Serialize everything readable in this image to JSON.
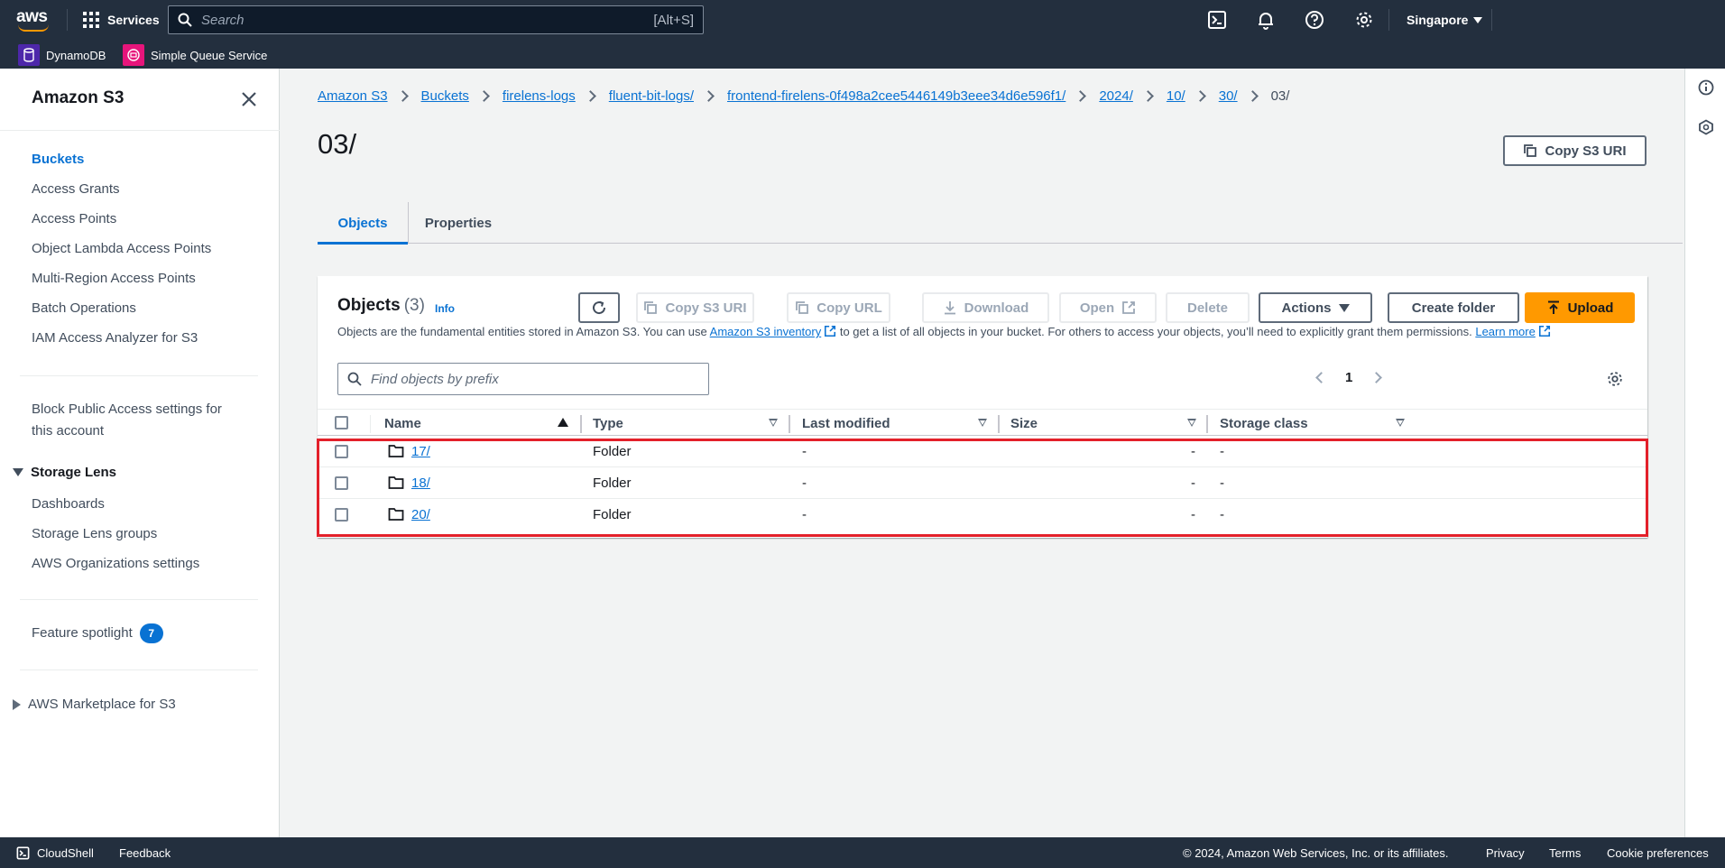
{
  "topnav": {
    "services_label": "Services",
    "search_placeholder": "Search",
    "search_shortcut": "[Alt+S]",
    "region": "Singapore"
  },
  "favorites": [
    {
      "label": "DynamoDB",
      "color": "#4d27aa"
    },
    {
      "label": "Simple Queue Service",
      "color": "#e7157b"
    }
  ],
  "sidebar": {
    "title": "Amazon S3",
    "items": [
      "Buckets",
      "Access Grants",
      "Access Points",
      "Object Lambda Access Points",
      "Multi-Region Access Points",
      "Batch Operations",
      "IAM Access Analyzer for S3"
    ],
    "block_public_line1": "Block Public Access settings for",
    "block_public_line2": "this account",
    "storage_lens": {
      "heading": "Storage Lens",
      "items": [
        "Dashboards",
        "Storage Lens groups",
        "AWS Organizations settings"
      ]
    },
    "feature_spotlight": "Feature spotlight",
    "feature_count": "7",
    "marketplace": "AWS Marketplace for S3"
  },
  "breadcrumbs": [
    "Amazon S3",
    "Buckets",
    "firelens-logs",
    "fluent-bit-logs/",
    "frontend-firelens-0f498a2cee5446149b3eee34d6e596f1/",
    "2024/",
    "10/",
    "30/",
    "03/"
  ],
  "page": {
    "title": "03/",
    "copy_uri_label": "Copy S3 URI"
  },
  "tabs": [
    "Objects",
    "Properties"
  ],
  "objects_panel": {
    "title": "Objects",
    "count": "(3)",
    "info": "Info",
    "buttons": {
      "copy_s3_uri": "Copy S3 URI",
      "copy_url": "Copy URL",
      "download": "Download",
      "open": "Open",
      "delete": "Delete",
      "actions": "Actions",
      "create_folder": "Create folder",
      "upload": "Upload"
    },
    "description_pre": "Objects are the fundamental entities stored in Amazon S3. You can use ",
    "description_link": "Amazon S3 inventory",
    "description_mid": " to get a list of all objects in your bucket. For others to access your objects, you’ll need to explicitly grant them permissions. ",
    "description_learn": "Learn more",
    "filter_placeholder": "Find objects by prefix",
    "page_number": "1",
    "columns": [
      "Name",
      "Type",
      "Last modified",
      "Size",
      "Storage class"
    ],
    "rows": [
      {
        "name": "17/",
        "type": "Folder",
        "last_modified": "-",
        "size": "-",
        "storage_class": "-"
      },
      {
        "name": "18/",
        "type": "Folder",
        "last_modified": "-",
        "size": "-",
        "storage_class": "-"
      },
      {
        "name": "20/",
        "type": "Folder",
        "last_modified": "-",
        "size": "-",
        "storage_class": "-"
      }
    ]
  },
  "footer": {
    "cloudshell": "CloudShell",
    "feedback": "Feedback",
    "copyright": "© 2024, Amazon Web Services, Inc. or its affiliates.",
    "privacy": "Privacy",
    "terms": "Terms",
    "cookies": "Cookie preferences"
  },
  "colors": {
    "nav_bg": "#232f3e",
    "link": "#0972d3",
    "primary": "#ff9900",
    "highlight": "#e3202a"
  }
}
